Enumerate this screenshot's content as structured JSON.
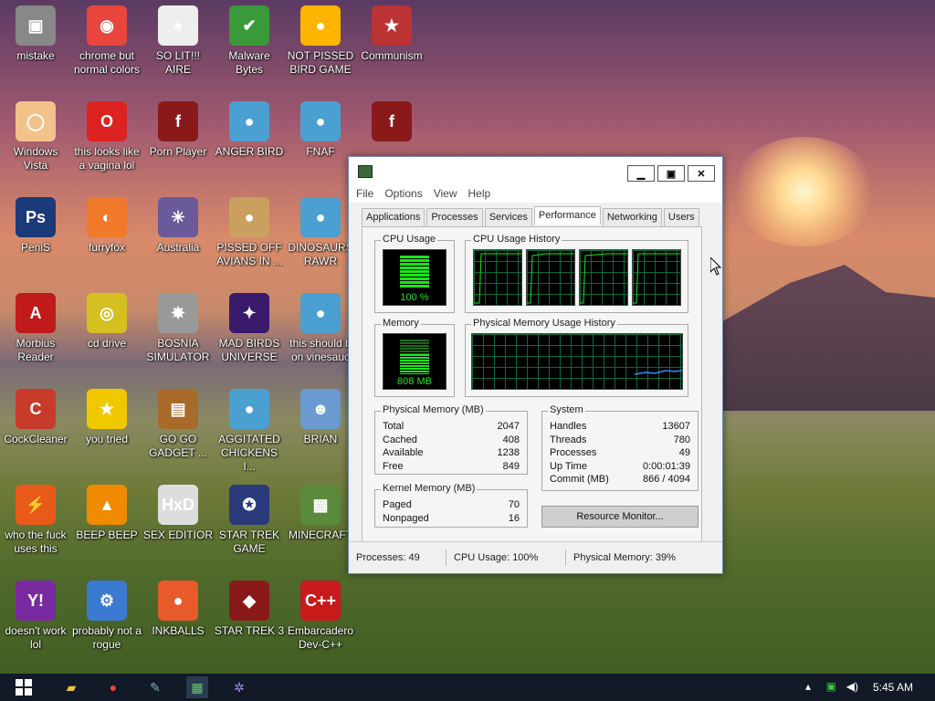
{
  "desktop": {
    "icons": [
      {
        "label": "mistake",
        "icon": "computer-icon",
        "bg": "#888"
      },
      {
        "label": "chrome but normal colors",
        "icon": "chrome-icon",
        "bg": "#e8453c"
      },
      {
        "label": "SO LIT!!! AIRE",
        "icon": "cards-icon",
        "bg": "#eee"
      },
      {
        "label": "Malware Bytes",
        "icon": "shield-icon",
        "bg": "#3a9a3a"
      },
      {
        "label": "NOT PISSED BIRD GAME",
        "icon": "pig-icon",
        "bg": "#ffb400"
      },
      {
        "label": "Communism",
        "icon": "emblem-icon",
        "bg": "#b33"
      },
      {
        "label": "Windows Vista",
        "icon": "egg-icon",
        "bg": "#f2c28a"
      },
      {
        "label": "this looks like a vagina lol",
        "icon": "opera-icon",
        "bg": "#d22"
      },
      {
        "label": "Porn Player",
        "icon": "flash-icon",
        "bg": "#8a1a1a"
      },
      {
        "label": "ANGER BIRD",
        "icon": "red-bird-icon",
        "bg": "#4aa0d0"
      },
      {
        "label": "FNAF",
        "icon": "red-bird-icon",
        "bg": "#4aa0d0"
      },
      {
        "label": "",
        "icon": "flash-icon",
        "bg": "#8a1a1a"
      },
      {
        "label": "PeniS",
        "icon": "photoshop-icon",
        "bg": "#1a3a7a"
      },
      {
        "label": "furryfox",
        "icon": "firefox-icon",
        "bg": "#f07a2a"
      },
      {
        "label": "Australia",
        "icon": "spider-icon",
        "bg": "#6a5a9a"
      },
      {
        "label": "PISSED OFF AVIANS IN ...",
        "icon": "seasons-icon",
        "bg": "#caa060"
      },
      {
        "label": "DINOSAURS RAWR",
        "icon": "red-bird-icon",
        "bg": "#4aa0d0"
      },
      {
        "label": "Morbius Reader",
        "icon": "acrobat-icon",
        "bg": "#c01a1a"
      },
      {
        "label": "cd drive",
        "icon": "cd-icon",
        "bg": "#d4c020"
      },
      {
        "label": "BOSNIA SIMULATOR",
        "icon": "mine-icon",
        "bg": "#999"
      },
      {
        "label": "MAD BIRDS UNIVERSE",
        "icon": "space-icon",
        "bg": "#3a1a6a"
      },
      {
        "label": "this should b on vinesauc",
        "icon": "red-bird-icon",
        "bg": "#4aa0d0"
      },
      {
        "label": "CockCleaner",
        "icon": "ccleaner-icon",
        "bg": "#c83a2a"
      },
      {
        "label": "you tried",
        "icon": "star-icon",
        "bg": "#f0c800"
      },
      {
        "label": "GO GO GADGET ...",
        "icon": "briefcase-icon",
        "bg": "#a86a2a"
      },
      {
        "label": "AGGITATED CHICKENS I...",
        "icon": "red-bird-icon",
        "bg": "#4aa0d0"
      },
      {
        "label": "BRIAN",
        "icon": "brian-icon",
        "bg": "#6a9ad0"
      },
      {
        "label": "who the fuck uses this",
        "icon": "bolt-icon",
        "bg": "#e85a1a"
      },
      {
        "label": "BEEP BEEP",
        "icon": "vlc-icon",
        "bg": "#f08a00"
      },
      {
        "label": "SEX EDITIOR",
        "icon": "hxd-icon",
        "bg": "#ddd"
      },
      {
        "label": "STAR TREK GAME",
        "icon": "starwars-icon",
        "bg": "#2a3a7a"
      },
      {
        "label": "MINECRAFT",
        "icon": "minecraft-icon",
        "bg": "#5a8a3a"
      },
      {
        "label": "doesn't work lol",
        "icon": "yahoo-icon",
        "bg": "#7a2aa0"
      },
      {
        "label": "probably not a rogue",
        "icon": "gears-icon",
        "bg": "#3a7ad0"
      },
      {
        "label": "INKBALLS",
        "icon": "ball-icon",
        "bg": "#e85a2a"
      },
      {
        "label": "STAR TREK 3",
        "icon": "trek-icon",
        "bg": "#8a1a1a"
      },
      {
        "label": "Embarcadero Dev-C++",
        "icon": "devcpp-icon",
        "bg": "#c81a1a"
      }
    ]
  },
  "taskmgr": {
    "menu": [
      "File",
      "Options",
      "View",
      "Help"
    ],
    "tabs": [
      "Applications",
      "Processes",
      "Services",
      "Performance",
      "Networking",
      "Users"
    ],
    "active_tab": "Performance",
    "cpu_usage_label": "CPU Usage",
    "cpu_usage_value": "100 %",
    "cpu_history_label": "CPU Usage History",
    "memory_label": "Memory",
    "memory_value": "808 MB",
    "mem_history_label": "Physical Memory Usage History",
    "physical_memory": {
      "title": "Physical Memory (MB)",
      "rows": [
        [
          "Total",
          "2047"
        ],
        [
          "Cached",
          "408"
        ],
        [
          "Available",
          "1238"
        ],
        [
          "Free",
          "849"
        ]
      ]
    },
    "kernel_memory": {
      "title": "Kernel Memory (MB)",
      "rows": [
        [
          "Paged",
          "70"
        ],
        [
          "Nonpaged",
          "16"
        ]
      ]
    },
    "system": {
      "title": "System",
      "rows": [
        [
          "Handles",
          "13607"
        ],
        [
          "Threads",
          "780"
        ],
        [
          "Processes",
          "49"
        ],
        [
          "Up Time",
          "0:00:01:39"
        ],
        [
          "Commit (MB)",
          "866 / 4094"
        ]
      ]
    },
    "resource_monitor_button": "Resource Monitor...",
    "status": {
      "processes": "Processes: 49",
      "cpu": "CPU Usage: 100%",
      "memory": "Physical Memory: 39%"
    }
  },
  "taskbar": {
    "clock": "5:45 AM"
  }
}
